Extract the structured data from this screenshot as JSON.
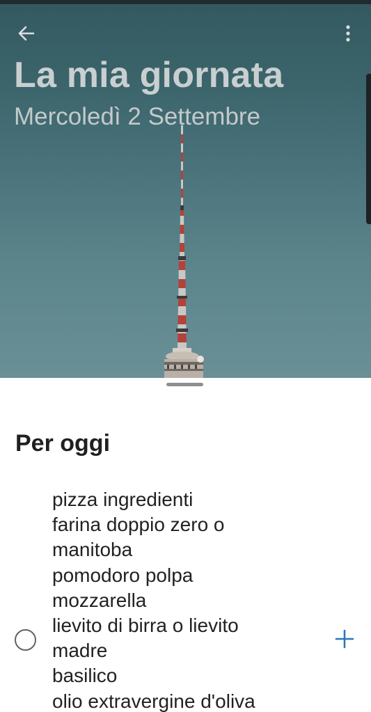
{
  "header": {
    "title": "La mia giornata",
    "subtitle": "Mercoledì 2 Settembre",
    "back_icon": "arrow-left-icon",
    "more_icon": "more-vertical-icon"
  },
  "list": {
    "section_title": "Per oggi",
    "tasks": [
      {
        "lines": [
          "pizza ingredienti",
          "farina doppio zero o",
          "manitoba",
          "pomodoro polpa",
          "mozzarella",
          "lievito di birra o lievito",
          "madre",
          "basilico",
          "olio extravergine d'oliva"
        ],
        "completed": false,
        "add_icon": "plus-icon"
      }
    ]
  },
  "colors": {
    "accent": "#2f74c0",
    "hero_top": "#33595f",
    "hero_bottom": "#6a9096",
    "title_text": "#c9cfd0"
  }
}
